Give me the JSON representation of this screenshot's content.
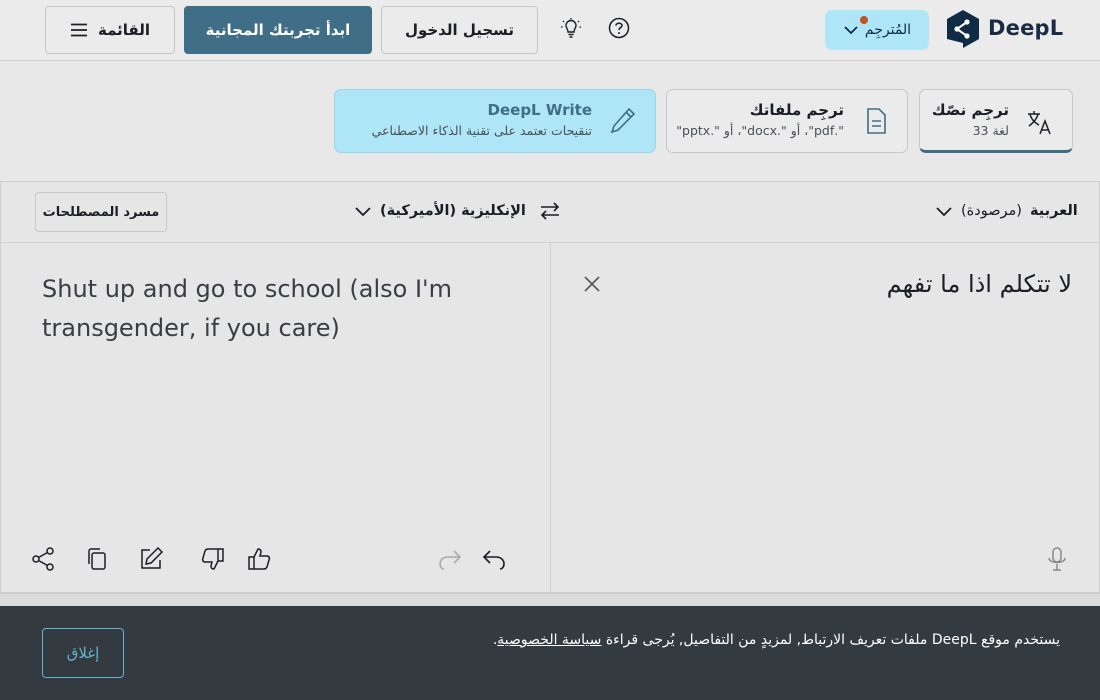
{
  "header": {
    "brand": "DeepL",
    "translator_label": "المُترجِم",
    "login_label": "تسجيل الدخول",
    "trial_label": "ابدأ تجربتك المجانية",
    "menu_label": "القائمة"
  },
  "modes": {
    "text": {
      "title": "ترجِم نصّك",
      "subtitle": "33 لغة"
    },
    "files": {
      "title": "ترجِم ملفاتك",
      "subtitle": "\".pdf\"، أو \".docx\"، أو \".pptx\""
    },
    "write": {
      "title": "DeepL Write",
      "subtitle": "تنقيحات تعتمد على تقنية الذكاء الاصطناعي"
    }
  },
  "translator": {
    "source_lang": "العربية",
    "source_lang_note": "(مرصودة)",
    "target_lang": "الإنكليزية (الأميركية)",
    "glossary_label": "مسرد المصطلحات",
    "source_text": "لا تتكلم اذا ما تفهم",
    "target_text": "Shut up and go to school (also I'm transgender, if you care)"
  },
  "cookie": {
    "text": "يستخدم موقع DeepL ملفات تعريف الارتباط, لمزيدٍ من التفاصيل, يُرجى قراءة",
    "link": "سياسة الخصوصية",
    "end": ".",
    "close_label": "إغلاق"
  },
  "colors": {
    "accent": "#3f6e86",
    "light_accent": "#aee6f7",
    "cookie_bg": "#333a40",
    "notif_dot": "#c0561f"
  },
  "icons": [
    "deepl-logo-icon",
    "chevron-down-icon",
    "help-icon",
    "lightbulb-icon",
    "hamburger-icon",
    "translate-icon",
    "document-icon",
    "pencil-icon",
    "swap-icon",
    "close-icon",
    "microphone-icon",
    "undo-icon",
    "redo-icon",
    "thumbs-up-icon",
    "thumbs-down-icon",
    "edit-icon",
    "copy-icon",
    "share-icon"
  ]
}
